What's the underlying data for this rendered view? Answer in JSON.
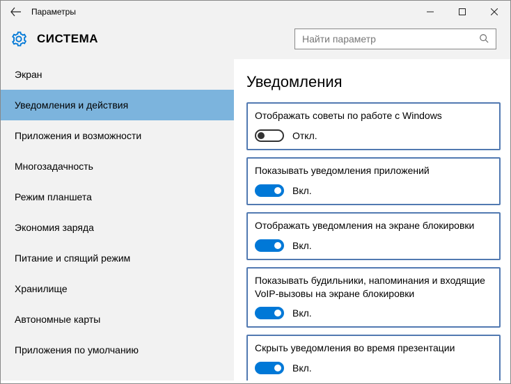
{
  "window_title": "Параметры",
  "page_title": "СИСТЕМА",
  "search_placeholder": "Найти параметр",
  "sidebar": {
    "items": [
      {
        "label": "Экран"
      },
      {
        "label": "Уведомления и действия"
      },
      {
        "label": "Приложения и возможности"
      },
      {
        "label": "Многозадачность"
      },
      {
        "label": "Режим планшета"
      },
      {
        "label": "Экономия заряда"
      },
      {
        "label": "Питание и спящий режим"
      },
      {
        "label": "Хранилище"
      },
      {
        "label": "Автономные карты"
      },
      {
        "label": "Приложения по умолчанию"
      }
    ],
    "active_index": 1
  },
  "content": {
    "heading": "Уведомления",
    "settings": [
      {
        "label": "Отображать советы по работе с Windows",
        "state": false,
        "state_text": "Откл."
      },
      {
        "label": "Показывать уведомления приложений",
        "state": true,
        "state_text": "Вкл."
      },
      {
        "label": "Отображать уведомления на экране блокировки",
        "state": true,
        "state_text": "Вкл."
      },
      {
        "label": "Показывать будильники, напоминания и входящие VoIP-вызовы на экране блокировки",
        "state": true,
        "state_text": "Вкл."
      },
      {
        "label": "Скрыть уведомления во время презентации",
        "state": true,
        "state_text": "Вкл."
      }
    ]
  }
}
